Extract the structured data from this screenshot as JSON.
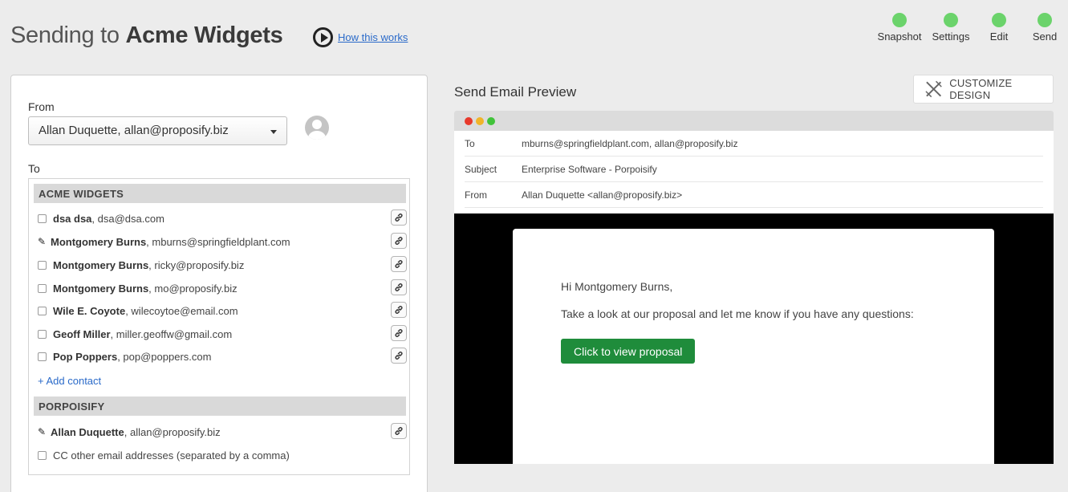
{
  "header": {
    "title_prefix": "Sending to ",
    "title_name": "Acme Widgets",
    "how_link": "How this works"
  },
  "steps": [
    {
      "label": "Snapshot",
      "color": "#6bd36b"
    },
    {
      "label": "Settings",
      "color": "#6bd36b"
    },
    {
      "label": "Edit",
      "color": "#6bd36b"
    },
    {
      "label": "Send",
      "color": "#6bd36b"
    }
  ],
  "from": {
    "label": "From",
    "selected": "Allan Duquette, allan@proposify.biz"
  },
  "to": {
    "label": "To",
    "groups": [
      {
        "name": "ACME WIDGETS",
        "contacts": [
          {
            "name": "dsa dsa",
            "email": ", dsa@dsa.com",
            "state": "checkbox"
          },
          {
            "name": "Montgomery Burns",
            "email": ", mburns@springfieldplant.com",
            "state": "pen"
          },
          {
            "name": "Montgomery Burns",
            "email": ", ricky@proposify.biz",
            "state": "checkbox"
          },
          {
            "name": "Montgomery Burns",
            "email": ", mo@proposify.biz",
            "state": "checkbox"
          },
          {
            "name": "Wile E. Coyote",
            "email": ", wilecoytoe@email.com",
            "state": "checkbox"
          },
          {
            "name": "Geoff Miller",
            "email": ", miller.geoffw@gmail.com",
            "state": "checkbox"
          },
          {
            "name": "Pop Poppers",
            "email": ", pop@poppers.com",
            "state": "checkbox"
          }
        ],
        "add_contact": "+ Add contact"
      },
      {
        "name": "PORPOISIFY",
        "contacts": [
          {
            "name": "Allan Duquette",
            "email": ", allan@proposify.biz",
            "state": "pen"
          }
        ]
      }
    ],
    "cc_label": "CC other email addresses (separated by a comma)"
  },
  "preview": {
    "title": "Send Email Preview",
    "customize_label": "CUSTOMIZE DESIGN",
    "window_dots": [
      "#e8392b",
      "#f0b429",
      "#41c33a"
    ],
    "headers": [
      {
        "key": "To",
        "value": "mburns@springfieldplant.com, allan@proposify.biz"
      },
      {
        "key": "Subject",
        "value": "Enterprise Software - Porpoisify"
      },
      {
        "key": "From",
        "value": "Allan Duquette <allan@proposify.biz>"
      }
    ],
    "greeting": "Hi Montgomery Burns,",
    "message": "Take a look at our proposal and let me know if you have any questions:",
    "cta": "Click to view proposal"
  }
}
